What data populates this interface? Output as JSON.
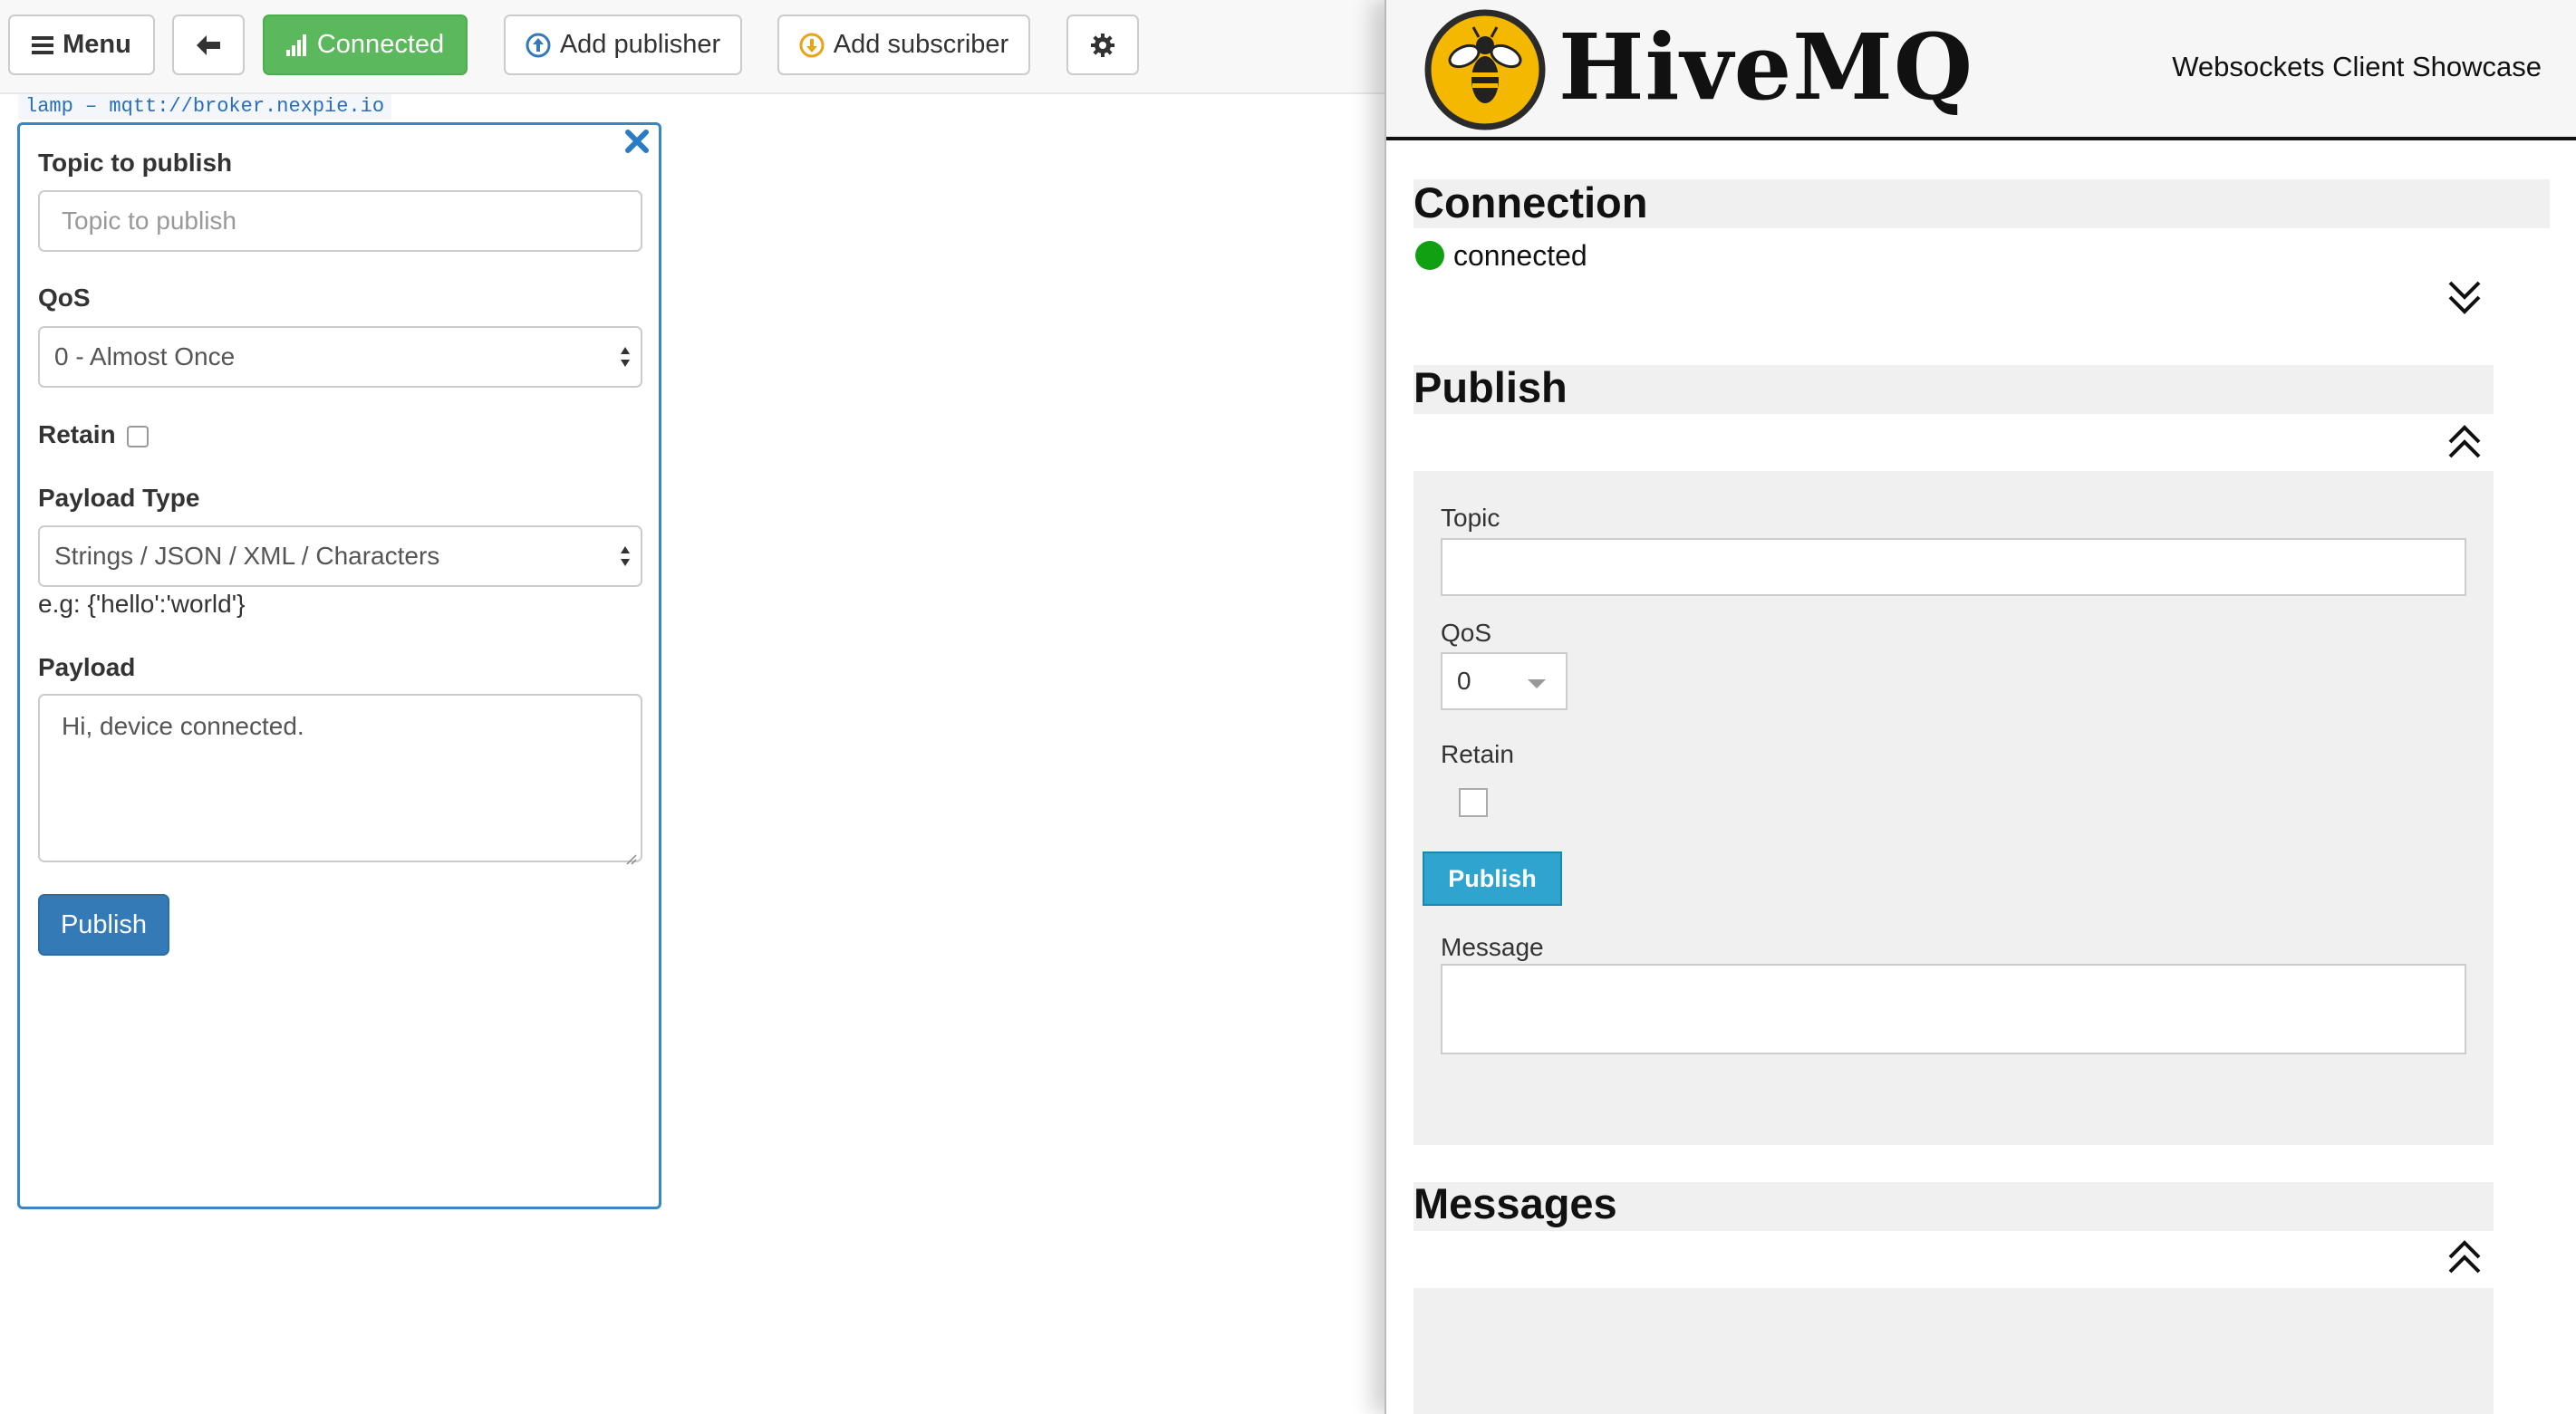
{
  "left_app": {
    "toolbar": {
      "menu_label": "Menu",
      "connected_label": "Connected",
      "add_publisher_label": "Add publisher",
      "add_subscriber_label": "Add subscriber"
    },
    "connection_label": "lamp – mqtt://broker.nexpie.io",
    "publisher": {
      "topic_label": "Topic to publish",
      "topic_placeholder": "Topic to publish",
      "qos_label": "QoS",
      "qos_value": "0 - Almost Once",
      "retain_label": "Retain",
      "payload_type_label": "Payload Type",
      "payload_type_value": "Strings / JSON / XML / Characters",
      "payload_hint": "e.g: {'hello':'world'}",
      "payload_label": "Payload",
      "payload_value": "Hi, device connected.",
      "publish_label": "Publish"
    },
    "colors": {
      "connected_green": "#5cb85c",
      "publish_blue": "#337ab7",
      "panel_border": "#3a85c6"
    }
  },
  "right_app": {
    "brand": "HiveMQ",
    "subtitle": "Websockets Client Showcase",
    "connection": {
      "title": "Connection",
      "status": "connected",
      "status_color": "#11a011"
    },
    "publish": {
      "title": "Publish",
      "topic_label": "Topic",
      "topic_value": "",
      "qos_label": "QoS",
      "qos_value": "0",
      "retain_label": "Retain",
      "publish_label": "Publish",
      "message_label": "Message",
      "message_value": ""
    },
    "messages": {
      "title": "Messages"
    },
    "colors": {
      "publish_button": "#2fa4cf",
      "section_bg": "#f0f0f0"
    }
  }
}
